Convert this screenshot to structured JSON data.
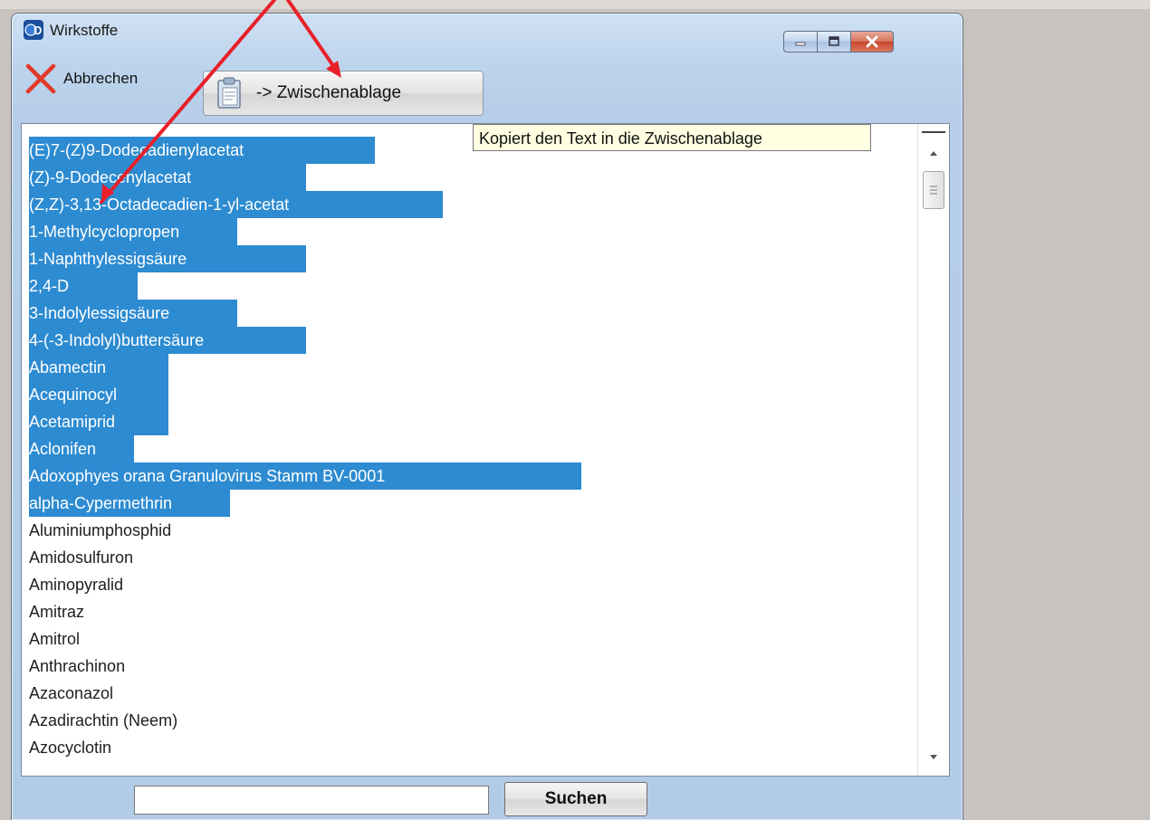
{
  "window": {
    "title": "Wirkstoffe",
    "app_icon": "4d-logo-icon",
    "controls": [
      "minimize-icon",
      "maximize-icon",
      "close-icon"
    ]
  },
  "toolbar": {
    "cancel_label": "Abbrechen",
    "cancel_icon": "red-x-icon",
    "copy_label": "-> Zwischenablage",
    "copy_icon": "clipboard-icon"
  },
  "tooltip": {
    "text": "Kopiert den Text in die Zwischenablage"
  },
  "list": {
    "items": [
      {
        "label": "(E)7-(Z)9-Dodecadienylacetat",
        "selected": true
      },
      {
        "label": "(Z)-9-Dodecenylacetat",
        "selected": true
      },
      {
        "label": "(Z,Z)-3,13-Octadecadien-1-yl-acetat",
        "selected": true
      },
      {
        "label": "1-Methylcyclopropen",
        "selected": true
      },
      {
        "label": "1-Naphthylessigsäure",
        "selected": true
      },
      {
        "label": "2,4-D",
        "selected": true
      },
      {
        "label": "3-Indolylessigsäure",
        "selected": true
      },
      {
        "label": "4-(-3-Indolyl)buttersäure",
        "selected": true
      },
      {
        "label": "Abamectin",
        "selected": true
      },
      {
        "label": "Acequinocyl",
        "selected": true
      },
      {
        "label": "Acetamiprid",
        "selected": true
      },
      {
        "label": "Aclonifen",
        "selected": true
      },
      {
        "label": "Adoxophyes orana Granulovirus Stamm BV-0001",
        "selected": true
      },
      {
        "label": "alpha-Cypermethrin",
        "selected": true
      },
      {
        "label": "Aluminiumphosphid",
        "selected": false
      },
      {
        "label": "Amidosulfuron",
        "selected": false
      },
      {
        "label": "Aminopyralid",
        "selected": false
      },
      {
        "label": "Amitraz",
        "selected": false
      },
      {
        "label": "Amitrol",
        "selected": false
      },
      {
        "label": "Anthrachinon",
        "selected": false
      },
      {
        "label": "Azaconazol",
        "selected": false
      },
      {
        "label": "Azadirachtin (Neem)",
        "selected": false
      },
      {
        "label": "Azocyclotin",
        "selected": false
      }
    ]
  },
  "search": {
    "value": "",
    "button_label": "Suchen"
  },
  "colors": {
    "selection": "#2d8bd1",
    "annotation_arrow": "#e8202a",
    "tooltip_bg": "#ffffe1"
  }
}
